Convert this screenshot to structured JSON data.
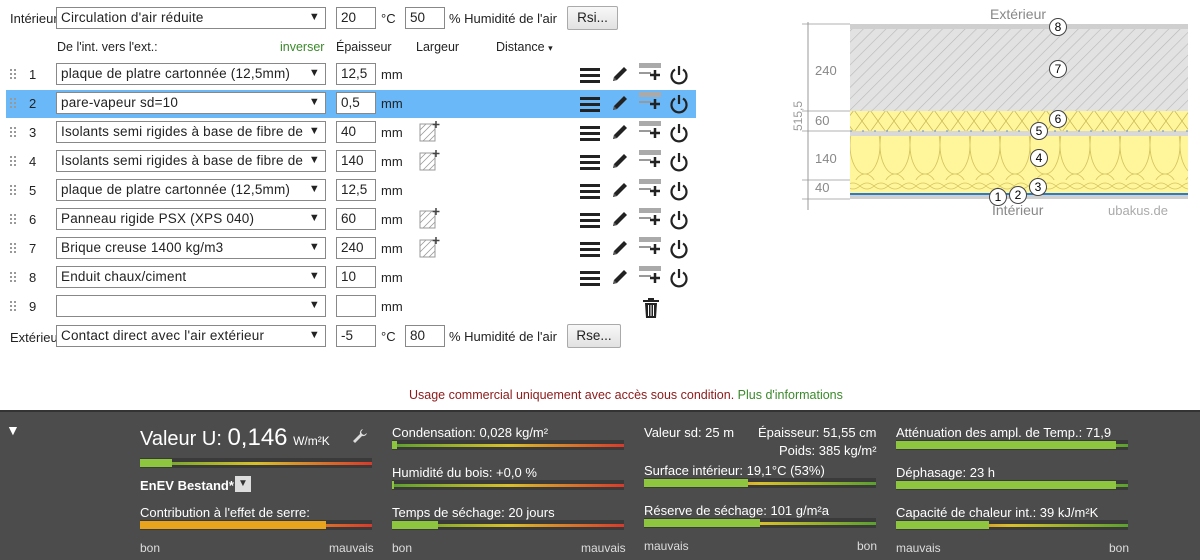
{
  "interior": {
    "label": "Intérieur",
    "condition": "Circulation d'air réduite",
    "temp": "20",
    "temp_unit": "°C",
    "humidity": "50",
    "humidity_label": "% Humidité de l'air",
    "rs_button": "Rsi..."
  },
  "exterior": {
    "label": "Extérieur",
    "condition": "Contact direct avec l'air extérieur",
    "temp": "-5",
    "temp_unit": "°C",
    "humidity": "80",
    "humidity_label": "% Humidité de l'air",
    "rs_button": "Rse..."
  },
  "columns": {
    "direction": "De l'int. vers l'ext.:",
    "inverse": "inverser",
    "thickness": "Épaisseur",
    "width": "Largeur",
    "distance": "Distance",
    "distance_caret": "▾"
  },
  "layers": [
    {
      "n": "1",
      "material": "plaque de platre cartonnée (12,5mm)",
      "thickness": "12,5",
      "unit": "mm",
      "hatch": false,
      "selected": false
    },
    {
      "n": "2",
      "material": "pare-vapeur sd=10",
      "thickness": "0,5",
      "unit": "mm",
      "hatch": false,
      "selected": true
    },
    {
      "n": "3",
      "material": "Isolants semi rigides à base de fibre de bois",
      "thickness": "40",
      "unit": "mm",
      "hatch": true,
      "selected": false
    },
    {
      "n": "4",
      "material": "Isolants semi rigides à base de fibre de bois",
      "thickness": "140",
      "unit": "mm",
      "hatch": true,
      "selected": false
    },
    {
      "n": "5",
      "material": "plaque de platre cartonnée (12,5mm)",
      "thickness": "12,5",
      "unit": "mm",
      "hatch": false,
      "selected": false
    },
    {
      "n": "6",
      "material": "Panneau rigide PSX (XPS 040)",
      "thickness": "60",
      "unit": "mm",
      "hatch": true,
      "selected": false
    },
    {
      "n": "7",
      "material": "Brique creuse 1400 kg/m3",
      "thickness": "240",
      "unit": "mm",
      "hatch": true,
      "selected": false
    },
    {
      "n": "8",
      "material": "Enduit chaux/ciment",
      "thickness": "10",
      "unit": "mm",
      "hatch": false,
      "selected": false
    },
    {
      "n": "9",
      "material": "",
      "thickness": "",
      "unit": "mm",
      "hatch": false,
      "selected": false
    }
  ],
  "diagram": {
    "top_label": "Extérieur",
    "bottom_label": "Intérieur",
    "watermark": "ubakus.de",
    "total": "515,5",
    "dims": [
      "240",
      "60",
      "140",
      "40"
    ],
    "markers": [
      "1",
      "2",
      "3",
      "4",
      "5",
      "6",
      "7",
      "8"
    ]
  },
  "notice": {
    "text": "Usage commercial uniquement avec accès sous condition.",
    "link": "Plus d'informations"
  },
  "results": {
    "toggle": "▼",
    "u_label": "Valeur U:",
    "u_value": "0,146",
    "u_unit": "W/m²K",
    "enev": "EnEV Bestand*",
    "enev_caret": "▼",
    "greenhouse": "Contribution à l'effet de serre:",
    "condensation": "Condensation: 0,028 kg/m²",
    "wood_humidity": "Humidité du bois: +0,0 %",
    "drying_time": "Temps de séchage: 20 jours",
    "sd": "Valeur sd: 25 m",
    "thickness": "Épaisseur: 51,55 cm",
    "weight": "Poids: 385 kg/m²",
    "surface_temp": "Surface intérieur: 19,1°C (53%)",
    "drying_reserve": "Réserve de séchage: 101 g/m²a",
    "attenuation": "Atténuation des ampl. de Temp.: 71,9",
    "phase_shift": "Déphasage: 23 h",
    "heat_capacity": "Capacité de chaleur int.: 39 kJ/m²K",
    "scale_good": "bon",
    "scale_bad": "mauvais"
  },
  "bars": {
    "u": 0.14,
    "greenhouse": 0.8,
    "condensation": 0.02,
    "wood": 0.01,
    "drying_time": 0.2,
    "surface": 0.45,
    "drying_reserve": 0.5,
    "attenuation": 0.95,
    "phase": 0.95,
    "capacity": 0.4
  },
  "colors": {
    "selected_row": "#6ab8f7",
    "link_green": "#3a8a2a",
    "notice_red": "#8b1a1a",
    "panel_bg": "#4c4c4c",
    "insulation_yellow": "#fff59a"
  }
}
